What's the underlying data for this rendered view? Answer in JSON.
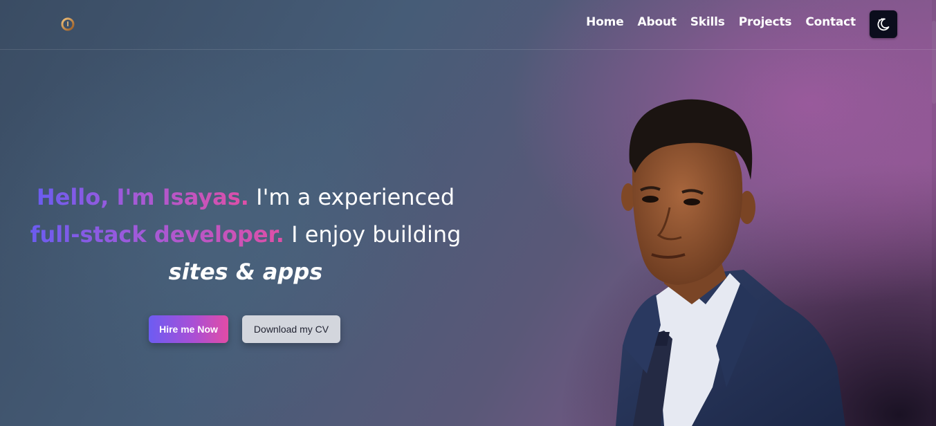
{
  "header": {
    "logo_icon": "stylized-monogram-logo",
    "nav": {
      "home": "Home",
      "about": "About",
      "skills": "Skills",
      "projects": "Projects",
      "contact": "Contact"
    },
    "theme_toggle_icon": "moon-stars-icon"
  },
  "hero": {
    "greeting": "Hello, I'm Isayas.",
    "line1_rest": " I'm a experienced",
    "role": "full-stack developer.",
    "line2_rest": " I enjoy building",
    "line3": "sites & apps",
    "hire_button": "Hire me Now",
    "cv_button": "Download my CV"
  },
  "colors": {
    "accent_start": "#6b5cf0",
    "accent_end": "#e04fa6",
    "toggle_bg": "#0b0d1c",
    "secondary_button": "#d3d6dd"
  },
  "portrait": "man-in-navy-suit-portrait"
}
